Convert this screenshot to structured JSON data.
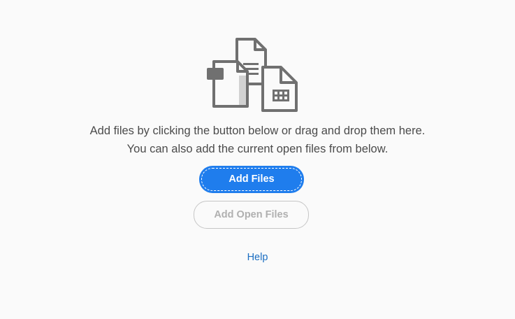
{
  "illustration": {
    "icon": "multiple-files-icon",
    "color": "#707070"
  },
  "instructions": {
    "line1": "Add files by clicking the button below or drag and drop them here.",
    "line2": "You can also add the current open files from below."
  },
  "actions": {
    "add_files_label": "Add Files",
    "add_open_files_label": "Add Open Files",
    "add_open_files_enabled": false
  },
  "help": {
    "label": "Help"
  },
  "colors": {
    "background": "#fafafa",
    "primary": "#1f7ded",
    "link": "#1b6ec2",
    "text": "#4b4b4b",
    "disabled": "#b0b0b0"
  }
}
